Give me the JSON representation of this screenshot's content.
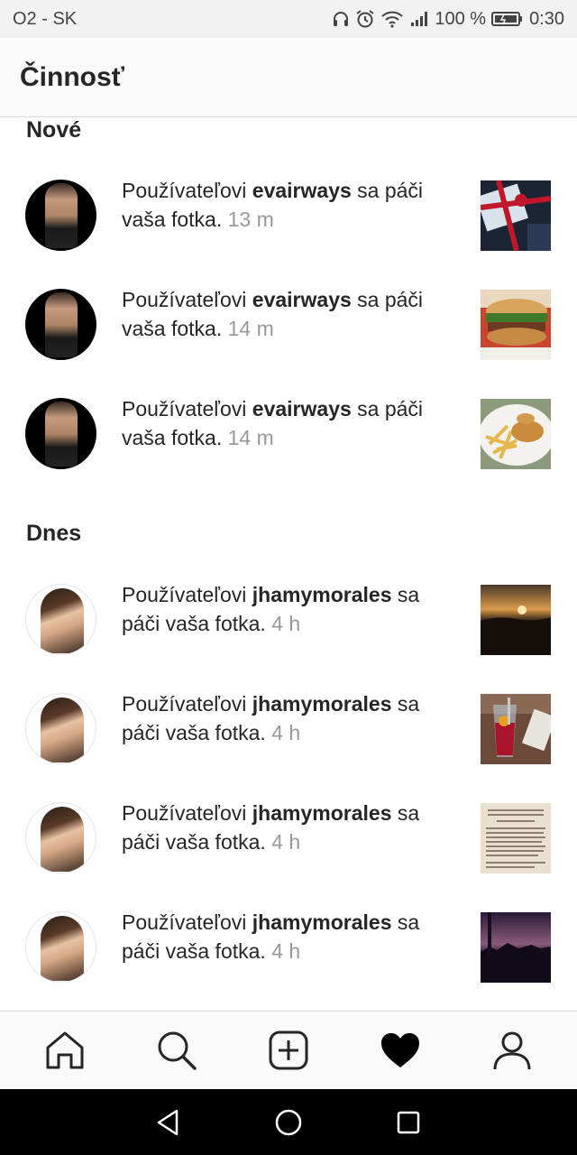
{
  "status_bar": {
    "carrier": "O2 - SK",
    "battery": "100 %",
    "time": "0:30",
    "icons": [
      "headphones-icon",
      "alarm-icon",
      "wifi-icon",
      "signal-icon",
      "battery-icon"
    ]
  },
  "header": {
    "title": "Činnosť"
  },
  "sections": [
    {
      "title": "Nové",
      "items": [
        {
          "prefix": "Používateľovi ",
          "user": "evairways",
          "suffix": " sa páči vaša fotka.",
          "time": "13 m"
        },
        {
          "prefix": "Používateľovi ",
          "user": "evairways",
          "suffix": " sa páči vaša fotka.",
          "time": "14 m"
        },
        {
          "prefix": "Používateľovi ",
          "user": "evairways",
          "suffix": " sa páči vaša fotka.",
          "time": "14 m"
        }
      ]
    },
    {
      "title": "Dnes",
      "items": [
        {
          "prefix": "Používateľovi ",
          "user": "jhamymorales",
          "suffix": " sa páči vaša fotka.",
          "time": "4 h"
        },
        {
          "prefix": "Používateľovi ",
          "user": "jhamymorales",
          "suffix": " sa páči vaša fotka.",
          "time": "4 h"
        },
        {
          "prefix": "Používateľovi ",
          "user": "jhamymorales",
          "suffix": " sa páči vaša fotka.",
          "time": "4 h"
        },
        {
          "prefix": "Používateľovi ",
          "user": "jhamymorales",
          "suffix": " sa páči vaša fotka.",
          "time": "4 h"
        }
      ]
    }
  ],
  "bottom_nav": [
    "home-icon",
    "search-icon",
    "new-post-icon",
    "heart-icon",
    "profile-icon"
  ],
  "android_nav": [
    "back-icon",
    "home-circle-icon",
    "recents-icon"
  ],
  "colors": {
    "text": "#262626",
    "muted": "#999999",
    "bar_bg": "#fafafa",
    "divider": "#dbdbdb"
  }
}
